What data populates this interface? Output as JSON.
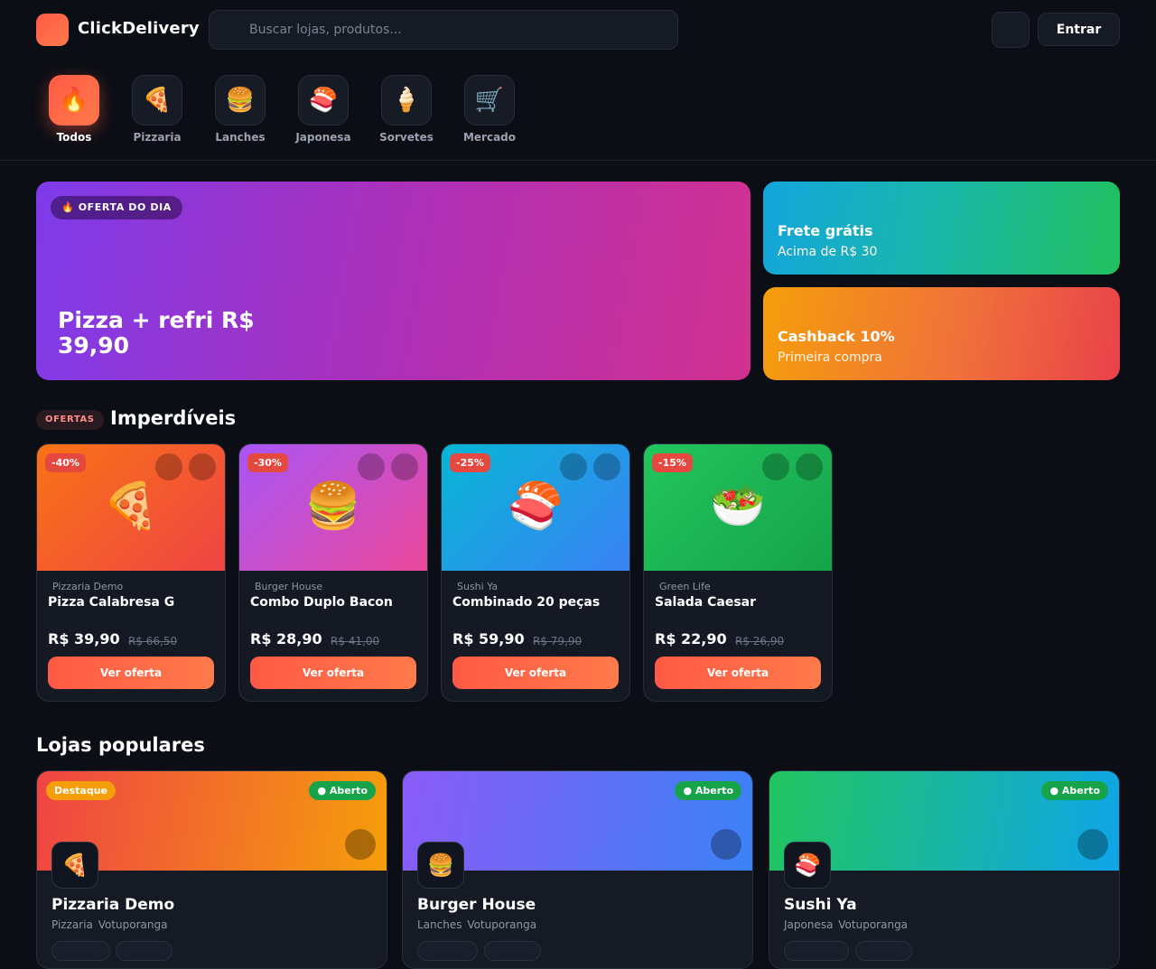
{
  "header": {
    "brand": "ClickDelivery",
    "search_placeholder": "Buscar lojas, produtos...",
    "login_label": "Entrar"
  },
  "categories": [
    {
      "icon": "🔥",
      "icon_name": "fire-icon",
      "label": "Todos",
      "active": true
    },
    {
      "icon": "🍕",
      "icon_name": "pizza-icon",
      "label": "Pizzaria",
      "active": false
    },
    {
      "icon": "🍔",
      "icon_name": "burger-icon",
      "label": "Lanches",
      "active": false
    },
    {
      "icon": "🍣",
      "icon_name": "sushi-icon",
      "label": "Japonesa",
      "active": false
    },
    {
      "icon": "🍦",
      "icon_name": "ice-cream-icon",
      "label": "Sorvetes",
      "active": false
    },
    {
      "icon": "🛒",
      "icon_name": "cart-icon",
      "label": "Mercado",
      "active": false
    }
  ],
  "hero": {
    "badge": "🔥 OFERTA DO DIA",
    "title": "Pizza + refri R$ 39,90"
  },
  "side_banners": [
    {
      "title": "Frete grátis",
      "subtitle": "Acima de R$ 30"
    },
    {
      "title": "Cashback 10%",
      "subtitle": "Primeira compra"
    }
  ],
  "offers_section": {
    "tag": "OFERTAS",
    "title": "Imperdíveis"
  },
  "offers": [
    {
      "discount": "-40%",
      "emoji": "🍕",
      "icon_name": "pizza-icon",
      "store": "Pizzaria Demo",
      "name": "Pizza Calabresa G",
      "price": "R$ 39,90",
      "old_price": "R$ 66,50",
      "button": "Ver oferta",
      "colors": [
        "#f97316",
        "#ef4444"
      ]
    },
    {
      "discount": "-30%",
      "emoji": "🍔",
      "icon_name": "burger-icon",
      "store": "Burger House",
      "name": "Combo Duplo Bacon",
      "price": "R$ 28,90",
      "old_price": "R$ 41,00",
      "button": "Ver oferta",
      "colors": [
        "#a855f7",
        "#ec4899"
      ]
    },
    {
      "discount": "-25%",
      "emoji": "🍣",
      "icon_name": "sushi-icon",
      "store": "Sushi Ya",
      "name": "Combinado 20 peças",
      "price": "R$ 59,90",
      "old_price": "R$ 79,90",
      "button": "Ver oferta",
      "colors": [
        "#06b6d4",
        "#3b82f6"
      ]
    },
    {
      "discount": "-15%",
      "emoji": "🥗",
      "icon_name": "salad-icon",
      "store": "Green Life",
      "name": "Salada Caesar",
      "price": "R$ 22,90",
      "old_price": "R$ 26,90",
      "button": "Ver oferta",
      "colors": [
        "#22c55e",
        "#16a34a"
      ]
    }
  ],
  "stores_section": {
    "title": "Lojas populares"
  },
  "stores": [
    {
      "highlight": "Destaque",
      "status": "● Aberto",
      "emoji": "🍕",
      "icon_name": "pizza-icon",
      "name": "Pizzaria Demo",
      "category": "Pizzaria",
      "city": "Votuporanga",
      "colors": [
        "#ef4444",
        "#f59e0b"
      ]
    },
    {
      "highlight": "",
      "status": "● Aberto",
      "emoji": "🍔",
      "icon_name": "burger-icon",
      "name": "Burger House",
      "category": "Lanches",
      "city": "Votuporanga",
      "colors": [
        "#8b5cf6",
        "#3b82f6"
      ]
    },
    {
      "highlight": "",
      "status": "● Aberto",
      "emoji": "🍣",
      "icon_name": "sushi-icon",
      "name": "Sushi Ya",
      "category": "Japonesa",
      "city": "Votuporanga",
      "colors": [
        "#22c55e",
        "#0ea5e9"
      ]
    }
  ]
}
